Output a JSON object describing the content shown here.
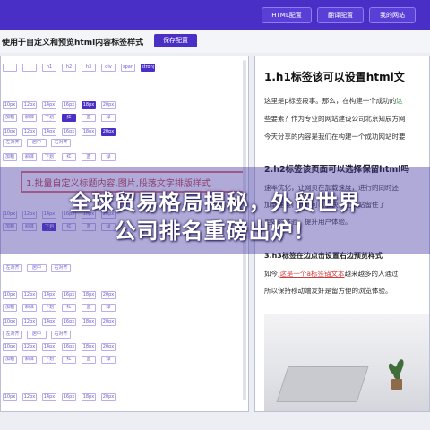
{
  "nav": {
    "buttons": [
      "HTML配置",
      "翻译配置",
      "我的网站"
    ]
  },
  "toolbar": {
    "title": "使用于自定义和预览html内容标签样式",
    "save_label": "保存配置"
  },
  "editor": {
    "tag_row": [
      "",
      "",
      "h1",
      "h2",
      "h3",
      "div",
      "span",
      "strong"
    ],
    "size_chips": [
      "10px",
      "12px",
      "14px",
      "16px",
      "18px",
      "20px"
    ],
    "style_chips": [
      "加粗",
      "斜体",
      "下划线",
      "红",
      "蓝",
      "绿"
    ],
    "align_chips": [
      "左对齐",
      "居中",
      "右对齐"
    ],
    "highlight_heading": "1.批量自定义标题内容,图片,段落文字排版样式"
  },
  "preview": {
    "h1": "1.h1标签该可以设置html文",
    "p1a": "这里是p标签段落",
    "p1b": "这里是p标签段事。那么，在构建一个成功的",
    "p1b_green": "这",
    "p2": "些要素？作为专业的网站建设公司北京知辰方网",
    "p3": "今天分享的内容是我们在构建一个成功网站时要",
    "h2": "2.h2标签该页面可以选择保留html吗",
    "p4": "速率优化，让网页在加载速度，进行的同时还",
    "p5": "加载速度，我们可以加快，让网站留住了",
    "p6": "更好的体验，提升用户体验。",
    "h3": "3.h3标签在边点击设置右边预览样式",
    "p7_prefix": "如今,",
    "p7_link": "这是一个a标签锚文本",
    "p7_suffix": "越来越多的人通过",
    "p8": "所以保持移动端友好是留方便的浏览体验。"
  },
  "banner": {
    "line1": "全球贸易格局揭秘，外贸世界",
    "line2": "公司排名重磅出炉！"
  },
  "colors": {
    "nav_bg": "#4a2fc6",
    "accent": "#4a2fc6",
    "link_red": "#d23c3c",
    "green_text": "#3b9a4f"
  }
}
